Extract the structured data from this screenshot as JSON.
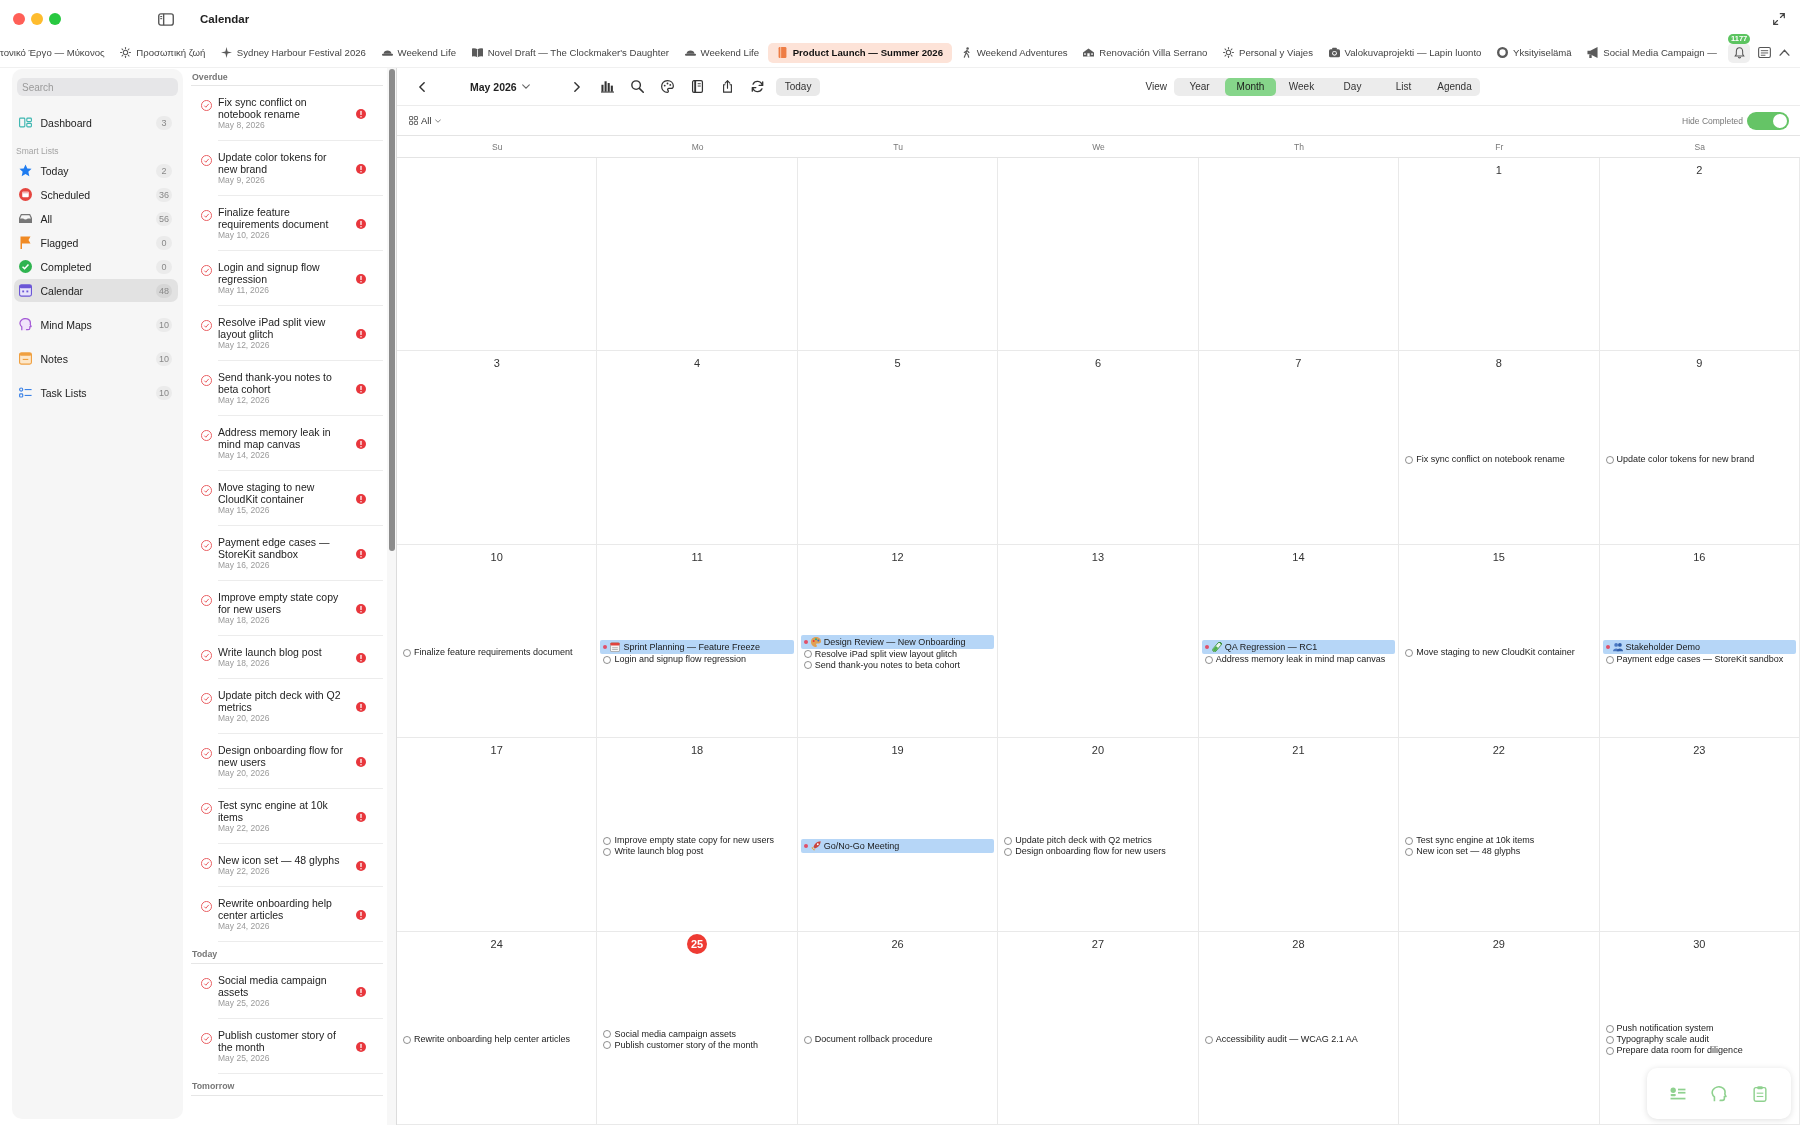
{
  "window": {
    "title": "Calendar"
  },
  "tabs": [
    {
      "label": "τονικό Έργο — Μύκονος",
      "selected": false
    },
    {
      "label": "Προσωπική ζωή",
      "selected": false
    },
    {
      "label": "Sydney Harbour Festival 2026",
      "selected": false
    },
    {
      "label": "Weekend Life",
      "selected": false
    },
    {
      "label": "Novel Draft — The Clockmaker's Daughter",
      "selected": false
    },
    {
      "label": "Weekend Life",
      "selected": false
    },
    {
      "label": "Product Launch — Summer 2026",
      "selected": true
    },
    {
      "label": "Weekend Adventures",
      "selected": false
    },
    {
      "label": "Renovación Villa Serrano",
      "selected": false
    },
    {
      "label": "Personal y Viajes",
      "selected": false
    },
    {
      "label": "Valokuvaprojekti — Lapin luonto",
      "selected": false
    },
    {
      "label": "Yksityiselämä",
      "selected": false
    },
    {
      "label": "Social Media Campaign —",
      "selected": false
    }
  ],
  "notifications": {
    "badge": "1177"
  },
  "sidebar": {
    "search": {
      "placeholder": "Search"
    },
    "groups": [
      {
        "items": [
          {
            "label": "Dashboard",
            "count": "3",
            "selected": false
          }
        ]
      },
      {
        "heading": "Smart Lists",
        "items": [
          {
            "label": "Today",
            "count": "2",
            "selected": false
          },
          {
            "label": "Scheduled",
            "count": "36",
            "selected": false
          },
          {
            "label": "All",
            "count": "56",
            "selected": false
          },
          {
            "label": "Flagged",
            "count": "0",
            "selected": false
          },
          {
            "label": "Completed",
            "count": "0",
            "selected": false
          },
          {
            "label": "Calendar",
            "count": "48",
            "selected": true
          }
        ]
      },
      {
        "items": [
          {
            "label": "Mind Maps",
            "count": "10",
            "selected": false
          }
        ]
      },
      {
        "items": [
          {
            "label": "Notes",
            "count": "10",
            "selected": false
          }
        ]
      },
      {
        "items": [
          {
            "label": "Task Lists",
            "count": "10",
            "selected": false
          }
        ]
      }
    ]
  },
  "task_list": {
    "sections": [
      {
        "heading": "Overdue",
        "tasks": [
          {
            "title": "Fix sync conflict on notebook rename",
            "date": "May 8, 2026"
          },
          {
            "title": "Update color tokens for new brand",
            "date": "May 9, 2026"
          },
          {
            "title": "Finalize feature requirements document",
            "date": "May 10, 2026"
          },
          {
            "title": "Login and signup flow regression",
            "date": "May 11, 2026"
          },
          {
            "title": "Resolve iPad split view layout glitch",
            "date": "May 12, 2026"
          },
          {
            "title": "Send thank-you notes to beta cohort",
            "date": "May 12, 2026"
          },
          {
            "title": "Address memory leak in mind map canvas",
            "date": "May 14, 2026"
          },
          {
            "title": "Move staging to new CloudKit container",
            "date": "May 15, 2026"
          },
          {
            "title": "Payment edge cases — StoreKit sandbox",
            "date": "May 16, 2026"
          },
          {
            "title": "Improve empty state copy for new users",
            "date": "May 18, 2026"
          },
          {
            "title": "Write launch blog post",
            "date": "May 18, 2026"
          },
          {
            "title": "Update pitch deck with Q2 metrics",
            "date": "May 20, 2026"
          },
          {
            "title": "Design onboarding flow for new users",
            "date": "May 20, 2026"
          },
          {
            "title": "Test sync engine at 10k items",
            "date": "May 22, 2026"
          },
          {
            "title": "New icon set — 48 glyphs",
            "date": "May 22, 2026"
          },
          {
            "title": "Rewrite onboarding help center articles",
            "date": "May 24, 2026"
          }
        ]
      },
      {
        "heading": "Today",
        "tasks": [
          {
            "title": "Social media campaign assets",
            "date": "May 25, 2026"
          },
          {
            "title": "Publish customer story of the month",
            "date": "May 25, 2026"
          }
        ]
      },
      {
        "heading": "Tomorrow"
      }
    ]
  },
  "calendar": {
    "toolbar": {
      "month": "May 2026",
      "today_button": "Today",
      "view_label": "View",
      "views": [
        {
          "label": "Year",
          "selected": false
        },
        {
          "label": "Month",
          "selected": true
        },
        {
          "label": "Week",
          "selected": false
        },
        {
          "label": "Day",
          "selected": false
        },
        {
          "label": "List",
          "selected": false
        },
        {
          "label": "Agenda",
          "selected": false
        }
      ]
    },
    "filter": {
      "label": "All"
    },
    "hide_completed": {
      "label": "Hide Completed",
      "on": true
    },
    "weekdays": [
      "Su",
      "Mo",
      "Tu",
      "We",
      "Th",
      "Fr",
      "Sa"
    ],
    "weeks": [
      [
        {
          "day": "1",
          "today": false
        },
        {
          "day": "2",
          "today": false
        }
      ],
      [
        {
          "day": "3",
          "today": false
        },
        {
          "day": "4",
          "today": false
        },
        {
          "day": "5",
          "today": false
        },
        {
          "day": "6",
          "today": false
        },
        {
          "day": "7",
          "today": false
        },
        {
          "day": "8",
          "today": false,
          "items": [
            {
              "kind": "task",
              "title": "Fix sync conflict on notebook rename",
              "checked": false
            }
          ]
        },
        {
          "day": "9",
          "today": false,
          "items": [
            {
              "kind": "task",
              "title": "Update color tokens for new brand",
              "checked": false
            }
          ]
        }
      ],
      [
        {
          "day": "10",
          "today": false,
          "items": [
            {
              "kind": "task",
              "title": "Finalize feature requirements document",
              "checked": false
            }
          ]
        },
        {
          "day": "11",
          "today": false,
          "items": [
            {
              "kind": "event",
              "title": "Sprint Planning — Feature Freeze"
            },
            {
              "kind": "task",
              "title": "Login and signup flow regression",
              "checked": false
            }
          ]
        },
        {
          "day": "12",
          "today": false,
          "items": [
            {
              "kind": "event",
              "title": "Design Review — New Onboarding"
            },
            {
              "kind": "task",
              "title": "Resolve iPad split view layout glitch",
              "checked": false
            },
            {
              "kind": "task",
              "title": "Send thank-you notes to beta cohort",
              "checked": false
            }
          ]
        },
        {
          "day": "13",
          "today": false
        },
        {
          "day": "14",
          "today": false,
          "items": [
            {
              "kind": "event",
              "title": "QA Regression — RC1"
            },
            {
              "kind": "task",
              "title": "Address memory leak in mind map canvas",
              "checked": false
            }
          ]
        },
        {
          "day": "15",
          "today": false,
          "items": [
            {
              "kind": "task",
              "title": "Move staging to new CloudKit container",
              "checked": false
            }
          ]
        },
        {
          "day": "16",
          "today": false,
          "items": [
            {
              "kind": "event",
              "title": "Stakeholder Demo"
            },
            {
              "kind": "task",
              "title": "Payment edge cases — StoreKit sandbox",
              "checked": false
            }
          ]
        }
      ],
      [
        {
          "day": "17",
          "today": false
        },
        {
          "day": "18",
          "today": false,
          "items": [
            {
              "kind": "task",
              "title": "Improve empty state copy for new users",
              "checked": false
            },
            {
              "kind": "task",
              "title": "Write launch blog post",
              "checked": false
            }
          ]
        },
        {
          "day": "19",
          "today": false,
          "items": [
            {
              "kind": "event",
              "title": "Go/No-Go Meeting"
            }
          ]
        },
        {
          "day": "20",
          "today": false,
          "items": [
            {
              "kind": "task",
              "title": "Update pitch deck with Q2 metrics",
              "checked": false
            },
            {
              "kind": "task",
              "title": "Design onboarding flow for new users",
              "checked": false
            }
          ]
        },
        {
          "day": "21",
          "today": false
        },
        {
          "day": "22",
          "today": false,
          "items": [
            {
              "kind": "task",
              "title": "Test sync engine at 10k items",
              "checked": false
            },
            {
              "kind": "task",
              "title": "New icon set — 48 glyphs",
              "checked": false
            }
          ]
        },
        {
          "day": "23",
          "today": false
        }
      ],
      [
        {
          "day": "24",
          "today": false,
          "items": [
            {
              "kind": "task",
              "title": "Rewrite onboarding help center articles",
              "checked": false
            }
          ]
        },
        {
          "day": "25",
          "today": true,
          "items": [
            {
              "kind": "task",
              "title": "Social media campaign assets",
              "checked": false
            },
            {
              "kind": "task",
              "title": "Publish customer story of the month",
              "checked": false
            }
          ]
        },
        {
          "day": "26",
          "today": false,
          "items": [
            {
              "kind": "task",
              "title": "Document rollback procedure",
              "checked": false
            }
          ]
        },
        {
          "day": "27",
          "today": false
        },
        {
          "day": "28",
          "today": false,
          "items": [
            {
              "kind": "task",
              "title": "Accessibility audit — WCAG 2.1 AA",
              "checked": false
            }
          ]
        },
        {
          "day": "29",
          "today": false
        },
        {
          "day": "30",
          "today": false,
          "items": [
            {
              "kind": "task",
              "title": "Push notification system",
              "checked": false
            },
            {
              "kind": "task",
              "title": "Typography scale audit",
              "checked": false
            },
            {
              "kind": "task",
              "title": "Prepare data room for diligence",
              "checked": false
            }
          ]
        }
      ]
    ]
  }
}
